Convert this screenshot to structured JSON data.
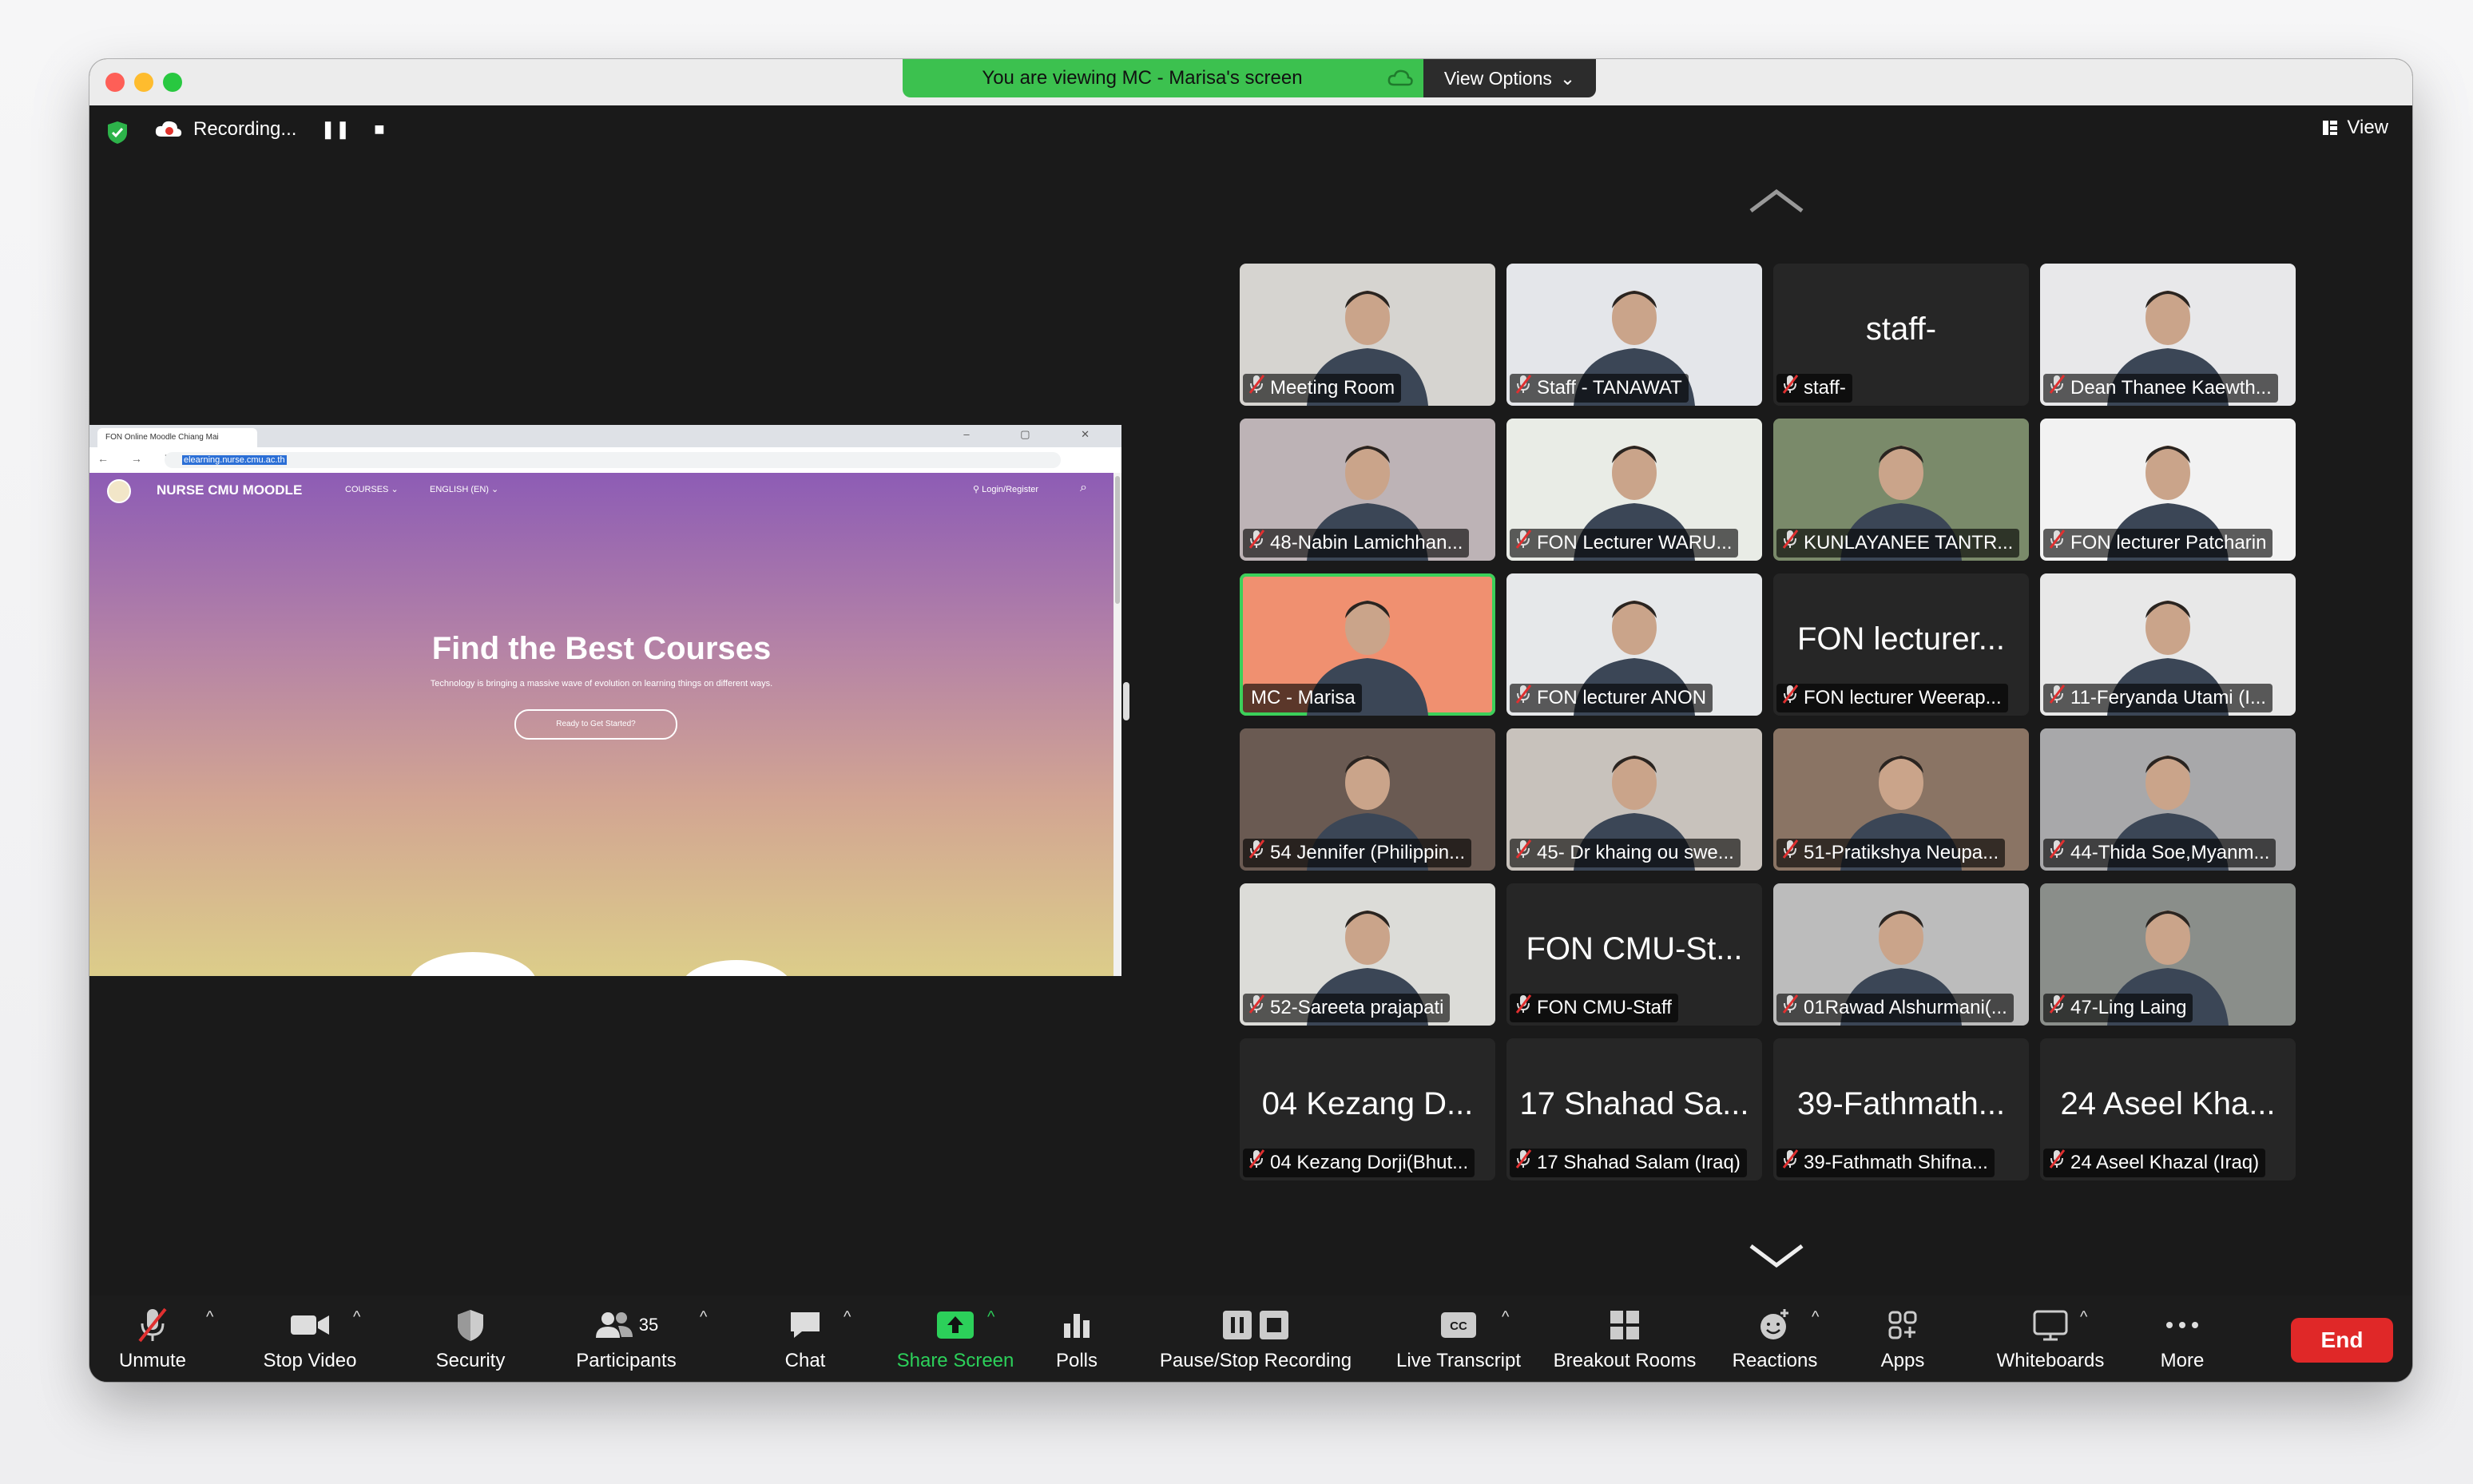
{
  "banner": {
    "viewing": "You are viewing MC - Marisa's screen",
    "view_options": "View Options"
  },
  "recording": {
    "label": "Recording..."
  },
  "view_button": "View",
  "shared_screen": {
    "tab_title": "FON Online Moodle Chiang Mai",
    "url": "elearning.nurse.cmu.ac.th",
    "brand": "NURSE CMU MOODLE",
    "nav_courses": "COURSES",
    "nav_lang": "ENGLISH (EN)",
    "login": "Login/Register",
    "hero_title": "Find the Best Courses",
    "hero_sub": "Technology is bringing a massive wave of evolution on learning things on different ways.",
    "hero_button": "Ready to Get Started?"
  },
  "tiles": [
    {
      "label": "Meeting Room",
      "big": "",
      "video": true,
      "bg": "#d6d4d0"
    },
    {
      "label": "Staff - TANAWAT",
      "big": "",
      "video": true,
      "bg": "#e4e6ea"
    },
    {
      "label": "staff-",
      "big": "staff-",
      "video": false,
      "bg": "#262626"
    },
    {
      "label": "Dean Thanee Kaewth...",
      "big": "",
      "video": true,
      "bg": "#e8e8ea"
    },
    {
      "label": "48-Nabin Lamichhan...",
      "big": "",
      "video": true,
      "bg": "#bdb3b6"
    },
    {
      "label": "FON Lecturer WARU...",
      "big": "",
      "video": true,
      "bg": "#e9ece6"
    },
    {
      "label": "KUNLAYANEE TANTR...",
      "big": "",
      "video": true,
      "bg": "#7a8a6a"
    },
    {
      "label": "FON lecturer Patcharin",
      "big": "",
      "video": true,
      "bg": "#f2f2f2"
    },
    {
      "label": "MC - Marisa",
      "big": "",
      "video": true,
      "bg": "#f09070",
      "active": true,
      "nomic": true
    },
    {
      "label": "FON lecturer ANON",
      "big": "",
      "video": true,
      "bg": "#e6e8ea"
    },
    {
      "label": "FON lecturer Weerap...",
      "big": "FON lecturer...",
      "video": false,
      "bg": "#262626"
    },
    {
      "label": "11-Feryanda Utami (I...",
      "big": "",
      "video": true,
      "bg": "#e8e8e8"
    },
    {
      "label": "54 Jennifer (Philippin...",
      "big": "",
      "video": true,
      "bg": "#6a5a52"
    },
    {
      "label": "45- Dr khaing ou swe...",
      "big": "",
      "video": true,
      "bg": "#c8c2bc"
    },
    {
      "label": "51-Pratikshya Neupa...",
      "big": "",
      "video": true,
      "bg": "#8a7464"
    },
    {
      "label": "44-Thida Soe,Myanm...",
      "big": "",
      "video": true,
      "bg": "#a8a8aa"
    },
    {
      "label": "52-Sareeta prajapati",
      "big": "",
      "video": true,
      "bg": "#dcdcd8"
    },
    {
      "label": "FON CMU-Staff",
      "big": "FON CMU-St...",
      "video": false,
      "bg": "#262626"
    },
    {
      "label": "01Rawad Alshurmani(...",
      "big": "",
      "video": true,
      "bg": "#bcbcbc"
    },
    {
      "label": "47-Ling Laing",
      "big": "",
      "video": true,
      "bg": "#8a8e8a"
    },
    {
      "label": "04 Kezang Dorji(Bhut...",
      "big": "04 Kezang D...",
      "video": false,
      "bg": "#262626"
    },
    {
      "label": "17 Shahad Salam (Iraq)",
      "big": "17 Shahad Sa...",
      "video": false,
      "bg": "#262626"
    },
    {
      "label": "39-Fathmath Shifna...",
      "big": "39-Fathmath...",
      "video": false,
      "bg": "#262626"
    },
    {
      "label": "24 Aseel Khazal (Iraq)",
      "big": "24 Aseel Kha...",
      "video": false,
      "bg": "#262626"
    }
  ],
  "toolbar": {
    "unmute": "Unmute",
    "stop_video": "Stop Video",
    "security": "Security",
    "participants": "Participants",
    "participants_count": "35",
    "chat": "Chat",
    "share_screen": "Share Screen",
    "polls": "Polls",
    "pause_stop_recording": "Pause/Stop Recording",
    "live_transcript": "Live Transcript",
    "live_transcript_cc": "CC",
    "breakout_rooms": "Breakout Rooms",
    "reactions": "Reactions",
    "apps": "Apps",
    "whiteboards": "Whiteboards",
    "more": "More",
    "end": "End"
  },
  "colors": {
    "accent_green": "#2cd05a",
    "end_red": "#e02828",
    "banner_green": "#3cc14f"
  }
}
